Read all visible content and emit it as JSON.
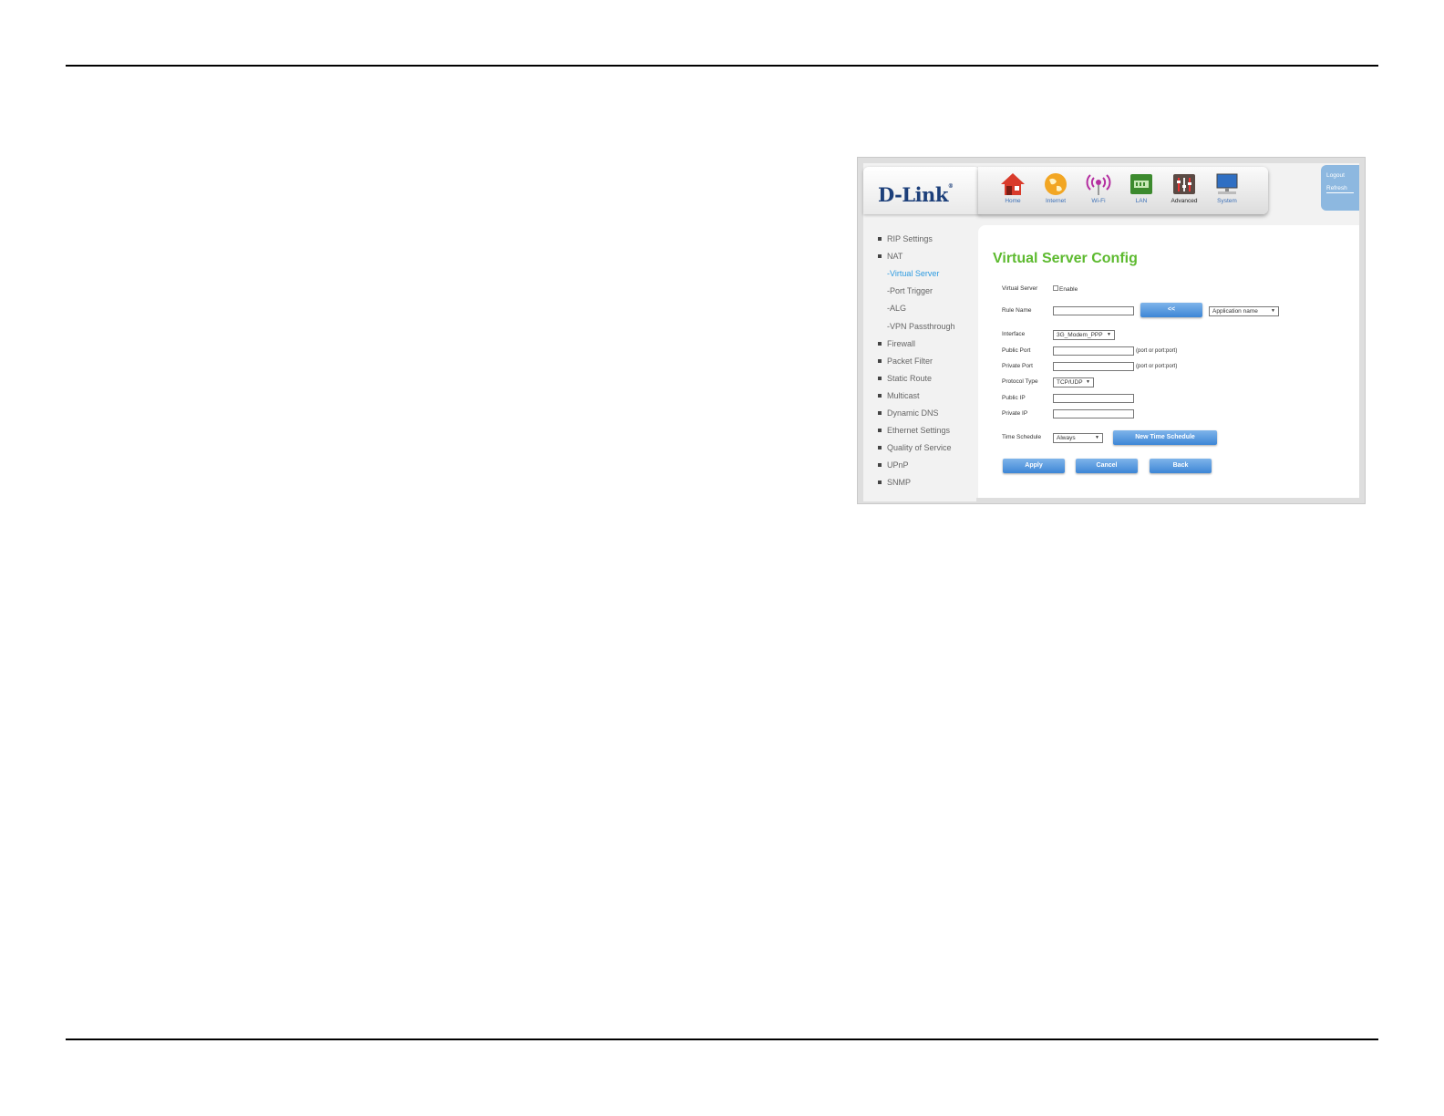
{
  "brand": {
    "logo_text": "D-Link",
    "logo_mark": "®"
  },
  "nav": [
    {
      "label": "Home",
      "icon": "home-icon"
    },
    {
      "label": "Internet",
      "icon": "globe-icon"
    },
    {
      "label": "Wi-Fi",
      "icon": "wifi-icon"
    },
    {
      "label": "LAN",
      "icon": "lan-icon"
    },
    {
      "label": "Advanced",
      "icon": "advanced-icon",
      "active": true
    },
    {
      "label": "System",
      "icon": "monitor-icon"
    }
  ],
  "account": {
    "logout": "Logout",
    "refresh": "Refresh"
  },
  "sidebar": {
    "items": [
      {
        "label": "RIP Settings"
      },
      {
        "label": "NAT"
      },
      {
        "label": "Firewall"
      },
      {
        "label": "Packet Filter"
      },
      {
        "label": "Static Route"
      },
      {
        "label": "Multicast"
      },
      {
        "label": "Dynamic DNS"
      },
      {
        "label": "Ethernet Settings"
      },
      {
        "label": "Quality of Service"
      },
      {
        "label": "UPnP"
      },
      {
        "label": "SNMP"
      }
    ],
    "nat_sub": [
      {
        "label": "-Virtual Server",
        "active": true
      },
      {
        "label": "-Port Trigger"
      },
      {
        "label": "-ALG"
      },
      {
        "label": "-VPN Passthrough"
      }
    ]
  },
  "form": {
    "title": "Virtual Server Config",
    "virtual_server_label": "Virtual Server",
    "enable_label": "Enable",
    "rule_name_label": "Rule Name",
    "rule_name_value": "",
    "copy_button": "<<",
    "app_name_select": "Application name",
    "interface_label": "Interface",
    "interface_value": "3G_Modem_PPP",
    "public_port_label": "Public Port",
    "private_port_label": "Private Port",
    "port_hint": "(port or port:port)",
    "protocol_label": "Protocol Type",
    "protocol_value": "TCP/UDP",
    "public_ip_label": "Public IP",
    "private_ip_label": "Private IP",
    "time_schedule_label": "Time Schedule",
    "time_schedule_value": "Always",
    "new_schedule_button": "New Time Schedule",
    "apply_button": "Apply",
    "cancel_button": "Cancel",
    "back_button": "Back"
  },
  "colors": {
    "accent_blue": "#3d86d6",
    "title_green": "#5dba2f",
    "active_link": "#2e9be0"
  }
}
